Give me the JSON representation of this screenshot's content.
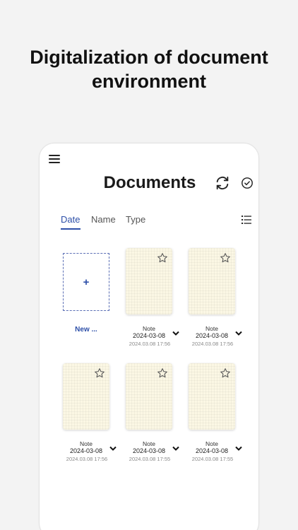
{
  "headline": {
    "line1": "Digitalization of document",
    "line2": "environment"
  },
  "app": {
    "title": "Documents",
    "menu_icon": "hamburger-menu-icon",
    "sync_icon": "sync-icon",
    "select_icon": "check-circle-icon",
    "list_icon": "list-view-icon"
  },
  "tabs": [
    {
      "label": "Date",
      "active": true
    },
    {
      "label": "Name",
      "active": false
    },
    {
      "label": "Type",
      "active": false
    }
  ],
  "new_doc": {
    "symbol": "+",
    "label": "New ..."
  },
  "docs": [
    {
      "name": "Note",
      "date": "2024-03-08",
      "time": "2024.03.08 17:56"
    },
    {
      "name": "Note",
      "date": "2024-03-08",
      "time": "2024.03.08 17:56"
    },
    {
      "name": "Note",
      "date": "2024-03-08",
      "time": "2024.03.08 17:56"
    },
    {
      "name": "Note",
      "date": "2024-03-08",
      "time": "2024.03.08 17:55"
    },
    {
      "name": "Note",
      "date": "2024-03-08",
      "time": "2024.03.08 17:55"
    }
  ],
  "colors": {
    "accent": "#2d4fa8",
    "thumb": "#fbf7e4",
    "background": "#f3f3f3"
  }
}
